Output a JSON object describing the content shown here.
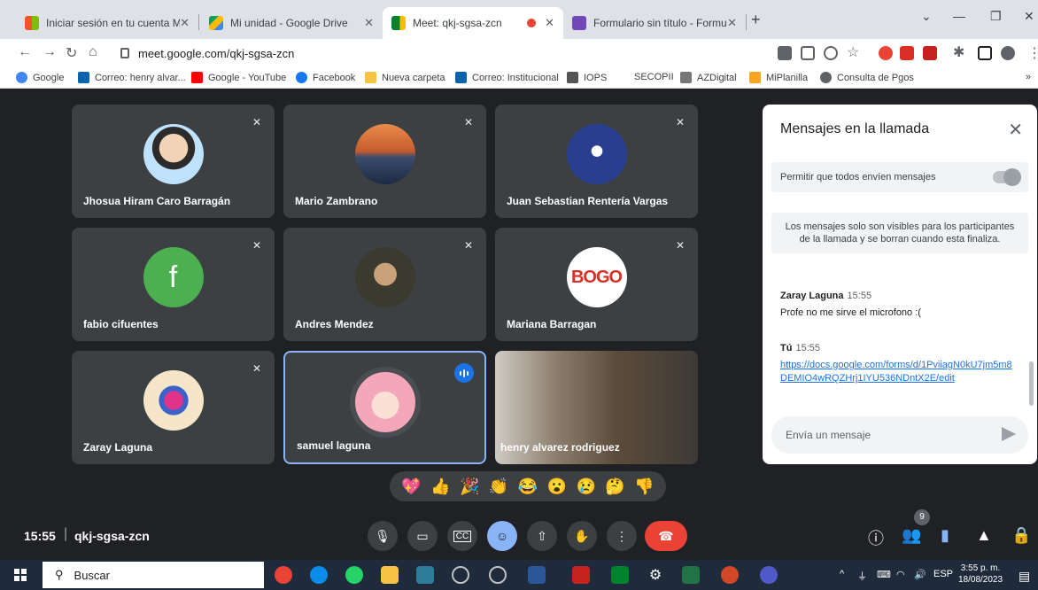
{
  "browser": {
    "tabs": [
      {
        "title": "Iniciar sesión en tu cuenta Micro",
        "favicon_color": "#f35325"
      },
      {
        "title": "Mi unidad - Google Drive",
        "favicon_color": "#fbbc04"
      },
      {
        "title": "Meet: qkj-sgsa-zcn",
        "favicon_color": "#00832d"
      },
      {
        "title": "Formulario sin título - Formulari",
        "favicon_color": "#7248b9"
      }
    ],
    "address": "meet.google.com/qkj-sgsa-zcn",
    "bookmarks": [
      {
        "label": "Google",
        "color": "#4285f4"
      },
      {
        "label": "Correo: henry alvar...",
        "color": "#0a64ad"
      },
      {
        "label": "Google - YouTube",
        "color": "#ff0000"
      },
      {
        "label": "Facebook",
        "color": "#1877f2"
      },
      {
        "label": "Nueva carpeta",
        "color": "#f6c344"
      },
      {
        "label": "Correo: Institucional",
        "color": "#0a64ad"
      },
      {
        "label": "IOPS",
        "color": "#555555"
      },
      {
        "label": "SECOPII",
        "color": "#ffffff"
      },
      {
        "label": "AZDigital",
        "color": "#777777"
      },
      {
        "label": "MiPlanilla",
        "color": "#f6a623"
      },
      {
        "label": "Consulta de Pgos",
        "color": "#5f6368"
      }
    ],
    "more_bookmarks": "»"
  },
  "participants": [
    {
      "name": "Jhosua Hiram Caro Barragán",
      "avatar_color": "#6ec6ff"
    },
    {
      "name": "Mario Zambrano",
      "avatar_color": "#e88b4a"
    },
    {
      "name": "Juan Sebastian Rentería Vargas",
      "avatar_color": "#2a3e8f"
    },
    {
      "name": "fabio cifuentes",
      "avatar_letter": "f",
      "avatar_color": "#4caf50"
    },
    {
      "name": "Andres Mendez",
      "avatar_color": "#6b5b4b"
    },
    {
      "name": "Mariana Barragan",
      "avatar_text": "BOGO",
      "avatar_color": "#ffffff"
    },
    {
      "name": "Zaray Laguna",
      "avatar_color": "#d9b3e6"
    },
    {
      "name": "samuel laguna",
      "avatar_color": "#f4a7b9"
    },
    {
      "name": "henry alvarez rodriguez"
    }
  ],
  "chat": {
    "title": "Mensajes en la llamada",
    "permit_label": "Permitir que todos envíen mensajes",
    "notice": "Los mensajes solo son visibles para los participantes de la llamada y se borran cuando esta finaliza.",
    "messages": [
      {
        "sender": "Zaray Laguna",
        "time": "15:55",
        "text": "Profe no me sirve el microfono :("
      },
      {
        "sender": "Tú",
        "time": "15:55",
        "link": "https://docs.google.com/forms/d/1PviiagN0kU7jm5m8DEMIO4wRQZHrj1IYU536NDntX2E/edit"
      }
    ],
    "composer_placeholder": "Envía un mensaje"
  },
  "reactions": [
    "💖",
    "👍",
    "🎉",
    "👏",
    "😂",
    "😮",
    "😢",
    "🤔",
    "👎"
  ],
  "meeting": {
    "time": "15:55",
    "separator": "|",
    "code": "qkj-sgsa-zcn",
    "participant_count": "9"
  },
  "taskbar": {
    "search_placeholder": "Buscar",
    "language": "ESP",
    "clock_time": "3:55 p. m.",
    "clock_date": "18/08/2023"
  }
}
